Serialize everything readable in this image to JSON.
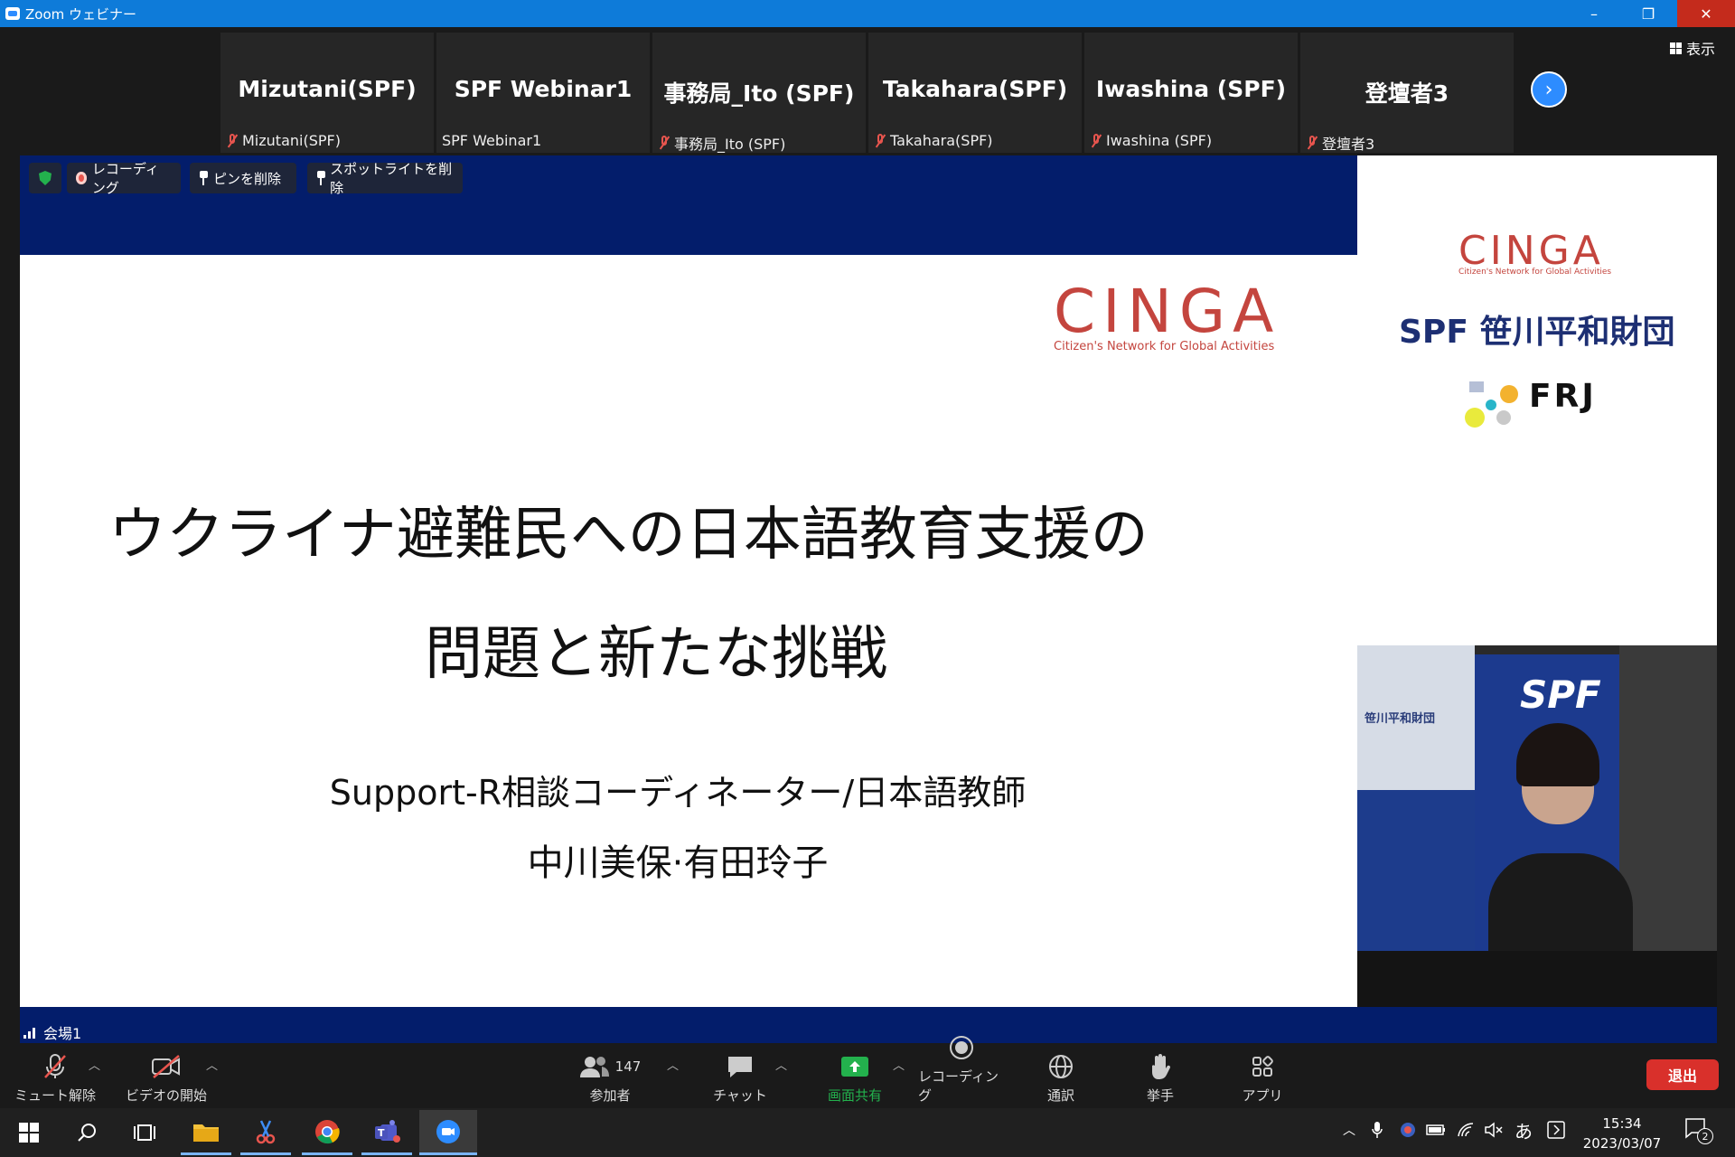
{
  "window": {
    "title": "Zoom ウェビナー",
    "minimize": "–",
    "restore": "❐",
    "close": "✕"
  },
  "gallery": {
    "tiles": [
      {
        "name": "Mizutani(SPF)",
        "label": "Mizutani(SPF)"
      },
      {
        "name": "SPF Webinar1",
        "label": "SPF Webinar1"
      },
      {
        "name": "事務局_Ito (SPF)",
        "label": "事務局_Ito (SPF)"
      },
      {
        "name": "Takahara(SPF)",
        "label": "Takahara(SPF)"
      },
      {
        "name": "Iwashina (SPF)",
        "label": "Iwashina (SPF)"
      },
      {
        "name": "登壇者3",
        "label": "登壇者3"
      }
    ],
    "next_icon": "›",
    "view_label": "表示"
  },
  "overlay": {
    "recording": "レコーディング",
    "unpin": "ピンを削除",
    "remove_spotlight": "スポットライトを削除"
  },
  "slide": {
    "logo_cinga": "CINGA",
    "logo_cinga_sub": "Citizen's Network for Global Activities",
    "title_line1": "ウクライナ避難民への日本語教育支援の",
    "title_line2": "問題と新たな挑戦",
    "subtitle": "Support-R相談コーディネーター/日本語教師",
    "presenters": "中川美保·有田玲子"
  },
  "logos": {
    "cinga": "CINGA",
    "cinga_sub": "Citizen's Network for Global Activities",
    "spf": "SPF 笹川平和財団",
    "frj": "FRJ"
  },
  "video": {
    "backdrop_text": "笹川平和財団",
    "backdrop_logo": "SPF"
  },
  "venue": "会場1",
  "toolbar": {
    "mute": "ミュート解除",
    "video": "ビデオの開始",
    "participants": "参加者",
    "participant_count": "147",
    "chat": "チャット",
    "share": "画面共有",
    "record": "レコーディング",
    "interpret": "通訳",
    "raise_hand": "挙手",
    "apps": "アプリ",
    "leave": "退出"
  },
  "taskbar": {
    "time": "15:34",
    "date": "2023/03/07",
    "ime": "あ",
    "notifications": "2"
  },
  "colors": {
    "zoom_blue": "#0e7bd9",
    "slide_navy": "#031d6b",
    "cinga_red": "#c4453e",
    "share_green": "#23b14d",
    "leave_red": "#d9302b"
  }
}
